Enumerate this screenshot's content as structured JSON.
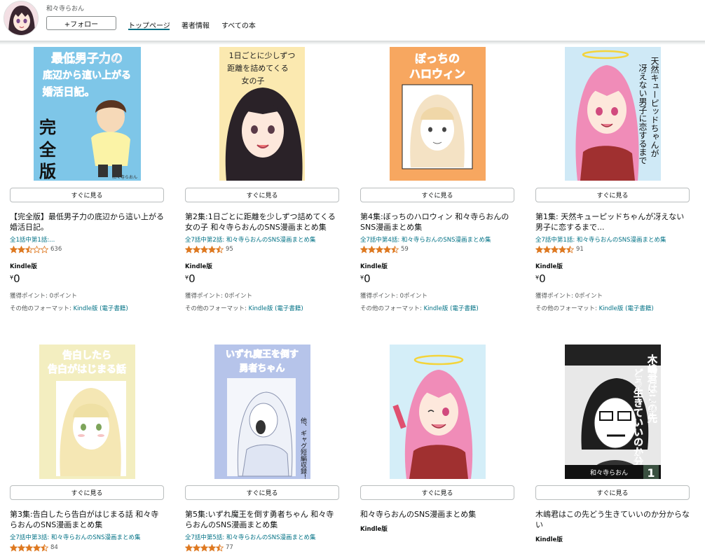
{
  "header": {
    "author_name": "和々寺らおん",
    "follow_label": "+フォロー",
    "tabs": [
      "トップページ",
      "著者情報",
      "すべての本"
    ]
  },
  "colors": {
    "link": "#007185",
    "star": "#de7921",
    "tab_underline": "#007185"
  },
  "books": [
    {
      "button": "すぐに見る",
      "title": "【完全版】最低男子力の底辺から這い上がる婚活日記。",
      "series": "全1話中第1話:...",
      "stars": 2.5,
      "rating_count": "636",
      "format": "Kindle版",
      "price_symbol": "¥",
      "price": "0",
      "points": "獲得ポイント: 0ポイント",
      "other_formats_label": "その他のフォーマット: ",
      "other_formats_link": "Kindle版 (電子書籍)",
      "cover": {
        "bg": "#7ec6e8",
        "text": [
          "最低男子力の",
          "底辺から這い上がる",
          "婚活日記。"
        ],
        "sub": "完全版",
        "credit": "和々寺らおん"
      }
    },
    {
      "button": "すぐに見る",
      "title": "第2集:1日ごとに距離を少しずつ詰めてくる女の子 和々寺らおんのSNS漫画まとめ集",
      "series": "全7話中第2話: 和々寺らおんのSNS漫画まとめ集",
      "stars": 4.5,
      "rating_count": "95",
      "format": "Kindle版",
      "price_symbol": "¥",
      "price": "0",
      "points": "獲得ポイント: 0ポイント",
      "other_formats_label": "その他のフォーマット: ",
      "other_formats_link": "Kindle版 (電子書籍)",
      "cover": {
        "bg": "#fbe9b0",
        "text": [
          "1日ごとに少しずつ",
          "距離を詰めてくる",
          "女の子"
        ]
      }
    },
    {
      "button": "すぐに見る",
      "title": "第4集:ぼっちのハロウィン 和々寺らおんのSNS漫画まとめ集",
      "series": "全7話中第4話: 和々寺らおんのSNS漫画まとめ集",
      "stars": 4.5,
      "rating_count": "59",
      "format": "Kindle版",
      "price_symbol": "¥",
      "price": "0",
      "points": "獲得ポイント: 0ポイント",
      "other_formats_label": "その他のフォーマット: ",
      "other_formats_link": "Kindle版 (電子書籍)",
      "cover": {
        "bg": "#f7a760",
        "text": [
          "ぼっちの",
          "ハロウィン"
        ]
      }
    },
    {
      "button": "すぐに見る",
      "title": "第1集: 天然キューピッドちゃんが冴えない男子に恋するまで...",
      "series": "全7話中第1話: 和々寺らおんのSNS漫画まとめ集",
      "stars": 4.5,
      "rating_count": "91",
      "format": "Kindle版",
      "price_symbol": "¥",
      "price": "0",
      "points": "獲得ポイント: 0ポイント",
      "other_formats_label": "その他のフォーマット: ",
      "other_formats_link": "Kindle版 (電子書籍)",
      "cover": {
        "bg": "#cfe9f6",
        "text": [
          "天然キューピッドちゃんが",
          "冴えない男子に恋するまで"
        ]
      }
    },
    {
      "button": "すぐに見る",
      "title": "第3集:告白したら告白がはじまる話 和々寺らおんのSNS漫画まとめ集",
      "series": "全7話中第3話: 和々寺らおんのSNS漫画まとめ集",
      "stars": 4.5,
      "rating_count": "84",
      "cover": {
        "bg": "#f3eec0",
        "text": [
          "告白したら",
          "告白がはじまる話"
        ]
      }
    },
    {
      "button": "すぐに見る",
      "title": "第5集:いずれ魔王を倒す勇者ちゃん 和々寺らおんのSNS漫画まとめ集",
      "series": "全7話中第5話: 和々寺らおんのSNS漫画まとめ集",
      "stars": 4.5,
      "rating_count": "77",
      "cover": {
        "bg": "#b6c4ea",
        "text": [
          "いずれ魔王を倒す",
          "勇者ちゃん"
        ],
        "side": "他、ギャグ短編収録！"
      }
    },
    {
      "button": "すぐに見る",
      "title": "和々寺らおんのSNS漫画まとめ集",
      "format": "Kindle版",
      "cover": {
        "bg": "#d4eef8",
        "text": []
      }
    },
    {
      "button": "すぐに見る",
      "title": "木嶋君はこの先どう生きていいのか分からない",
      "format": "Kindle版",
      "cover": {
        "bg": "#e8e8e8",
        "text": [
          "木嶋君はこの先",
          "どう生きていいのか分からない"
        ],
        "credit": "和々寺らおん",
        "num": "1"
      }
    }
  ]
}
